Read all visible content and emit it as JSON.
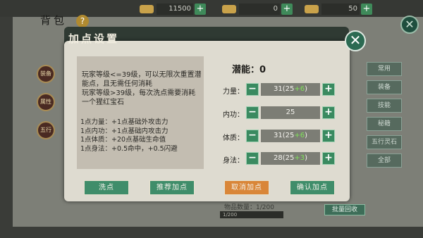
{
  "background": {
    "title": "背包",
    "help": "?",
    "currencies": [
      {
        "name": "gold-ingot",
        "value": "11500"
      },
      {
        "name": "gold-bar",
        "value": "0"
      },
      {
        "name": "ingot",
        "value": "50"
      }
    ],
    "side_buttons": [
      "装备",
      "属性",
      "五行"
    ],
    "right_tabs": [
      "常用",
      "装备",
      "技能",
      "秘籍",
      "五行灵石",
      "全部"
    ],
    "stats_label": "物品数量：1/200",
    "bar_value": "1/200",
    "recycle_button": "批量回收"
  },
  "modal": {
    "title": "加点设置",
    "info_text": "玩家等级<=39级，可以无限次重置潜能点，且无需任何消耗\n玩家等级>39级，每次洗点需要消耗一个猩红宝石",
    "info_list": [
      "1点力量：+1点基础外攻击力",
      "1点内功：+1点基础内攻击力",
      "1点体质：+20点基础生命值",
      "1点身法：+0.5命中，+0.5闪避"
    ],
    "potential_label": "潜能：0",
    "stats": [
      {
        "label": "力量：",
        "value": "31(25",
        "bonus": "+6",
        "close": ")"
      },
      {
        "label": "内功：",
        "value": "25",
        "bonus": "",
        "close": ""
      },
      {
        "label": "体质：",
        "value": "31(25",
        "bonus": "+6",
        "close": ")"
      },
      {
        "label": "身法：",
        "value": "28(25",
        "bonus": "+3",
        "close": ")"
      }
    ],
    "buttons": {
      "reset": "洗点",
      "recommend": "推荐加点",
      "cancel": "取消加点",
      "confirm": "确认加点"
    },
    "close_symbol": "✕",
    "minus_symbol": "−",
    "plus_symbol": "+"
  },
  "colors": {
    "accent_green": "#3a8a60",
    "cancel_orange": "#d98638",
    "bonus_green": "#7fe05a"
  }
}
